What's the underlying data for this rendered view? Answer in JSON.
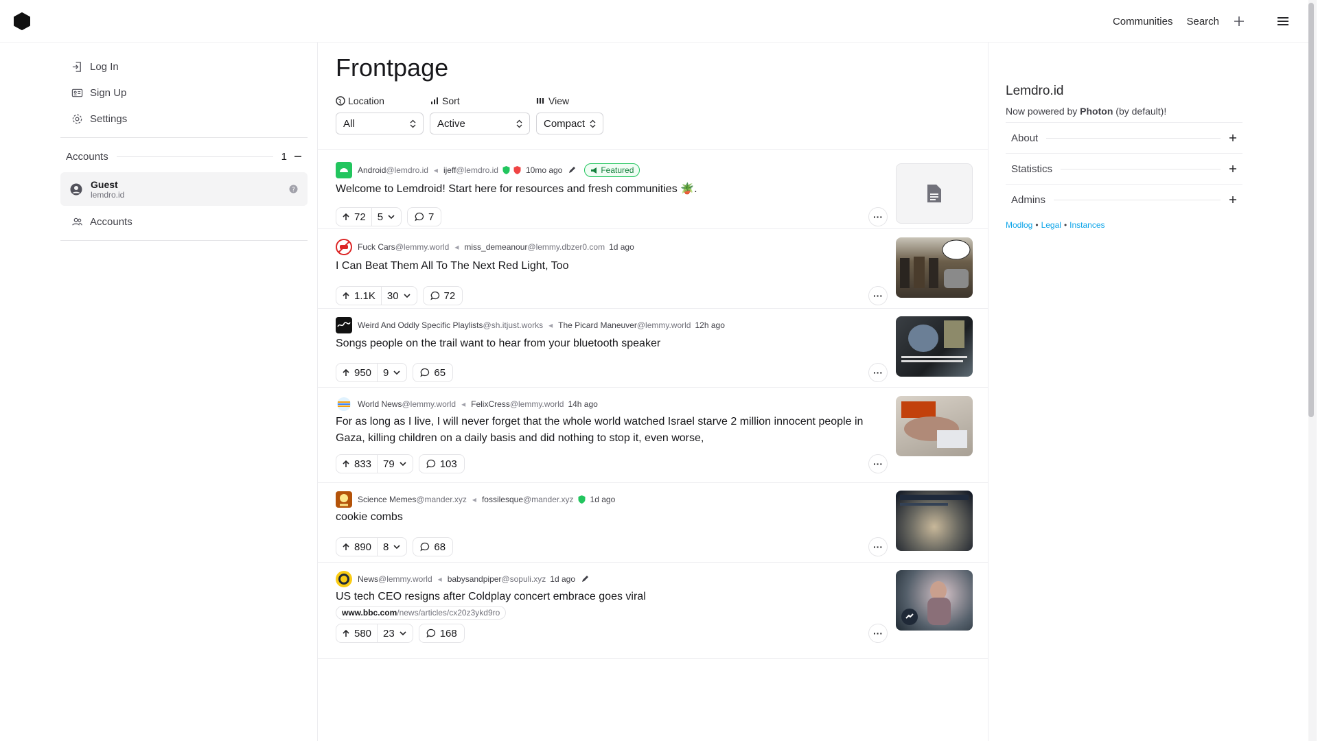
{
  "nav": {
    "communities": "Communities",
    "search": "Search"
  },
  "sidebar": {
    "login": "Log In",
    "signup": "Sign Up",
    "settings": "Settings",
    "accounts_title": "Accounts",
    "accounts_count": "1",
    "guest_name": "Guest",
    "guest_instance": "lemdro.id",
    "accounts_link": "Accounts"
  },
  "main": {
    "title": "Frontpage",
    "location_label": "Location",
    "location_value": "All",
    "sort_label": "Sort",
    "sort_value": "Active",
    "view_label": "View",
    "view_value": "Compact"
  },
  "posts": [
    {
      "community": "Android",
      "community_instance": "@lemdro.id",
      "author": "ijeff",
      "author_instance": "@lemdro.id",
      "time": "10mo ago",
      "badge": "Featured",
      "title": "Welcome to Lemdroid! Start here for resources and fresh communities 🪴.",
      "up": "72",
      "down": "5",
      "comments": "7"
    },
    {
      "community": "Fuck Cars",
      "community_instance": "@lemmy.world",
      "author": "miss_demeanour",
      "author_instance": "@lemmy.dbzer0.com",
      "time": "1d ago",
      "title": "I Can Beat Them All To The Next Red Light, Too",
      "up": "1.1K",
      "down": "30",
      "comments": "72"
    },
    {
      "community": "Weird And Oddly Specific Playlists",
      "community_instance": "@sh.itjust.works",
      "author": "The Picard Maneuver",
      "author_instance": "@lemmy.world",
      "time": "12h ago",
      "title": "Songs people on the trail want to hear from your bluetooth speaker",
      "up": "950",
      "down": "9",
      "comments": "65"
    },
    {
      "community": "World News",
      "community_instance": "@lemmy.world",
      "author": "FelixCress",
      "author_instance": "@lemmy.world",
      "time": "14h ago",
      "title": "For as long as I live, I will never forget that the whole world watched Israel starve 2 million innocent people in Gaza, killing children on a daily basis and did nothing to stop it, even worse,",
      "up": "833",
      "down": "79",
      "comments": "103"
    },
    {
      "community": "Science Memes",
      "community_instance": "@mander.xyz",
      "author": "fossilesque",
      "author_instance": "@mander.xyz",
      "time": "1d ago",
      "title": "cookie combs",
      "up": "890",
      "down": "8",
      "comments": "68"
    },
    {
      "community": "News",
      "community_instance": "@lemmy.world",
      "author": "babysandpiper",
      "author_instance": "@sopuli.xyz",
      "time": "1d ago",
      "title": "US tech CEO resigns after Coldplay concert embrace goes viral",
      "link_domain": "www.bbc.com",
      "link_path": "/news/articles/cx20z3ykd9ro",
      "up": "580",
      "down": "23",
      "comments": "168"
    }
  ],
  "right": {
    "site_name": "Lemdro.id",
    "powered_prefix": "Now powered by ",
    "powered_name": "Photon",
    "powered_suffix": " (by default)!",
    "about": "About",
    "statistics": "Statistics",
    "admins": "Admins",
    "modlog": "Modlog",
    "legal": "Legal",
    "instances": "Instances"
  },
  "colors": {
    "accent": "#0ea5e9",
    "featured": "#15803d",
    "text": "#18181b"
  }
}
